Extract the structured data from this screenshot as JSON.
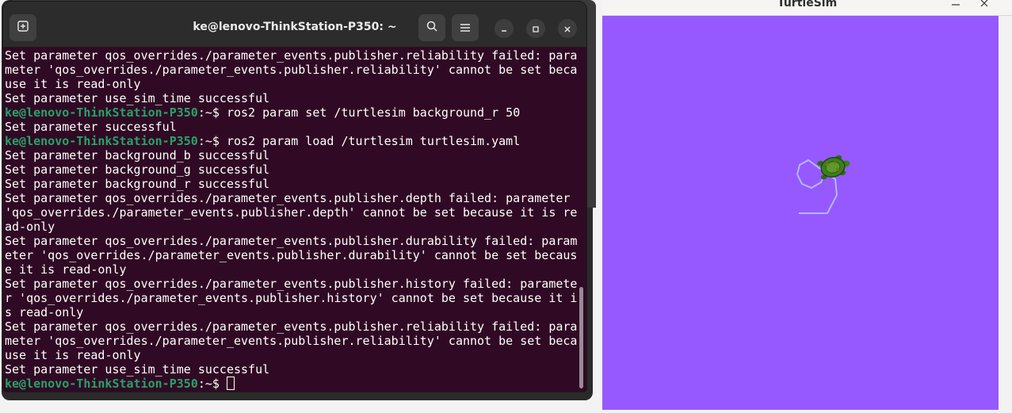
{
  "terminal": {
    "title": "ke@lenovo-ThinkStation-P350: ~",
    "icons": {
      "new_tab": "new-tab-icon",
      "search": "search-icon",
      "menu": "hamburger-menu-icon",
      "minimize": "minimize-icon",
      "maximize": "maximize-icon",
      "close": "close-icon"
    },
    "colors": {
      "background": "#300a24",
      "prompt_user": "#26a269",
      "text": "#ffffff"
    },
    "prompt_user": "ke@lenovo-ThinkStation-P350",
    "prompt_suffix": ":~$ ",
    "lines": [
      {
        "type": "text",
        "text": "Set parameter qos_overrides./parameter_events.publisher.reliability failed: para"
      },
      {
        "type": "text",
        "text": "meter 'qos_overrides./parameter_events.publisher.reliability' cannot be set beca"
      },
      {
        "type": "text",
        "text": "use it is read-only"
      },
      {
        "type": "text",
        "text": "Set parameter use_sim_time successful"
      },
      {
        "type": "prompt",
        "text": "ros2 param set /turtlesim background_r 50"
      },
      {
        "type": "text",
        "text": "Set parameter successful"
      },
      {
        "type": "prompt",
        "text": "ros2 param load /turtlesim turtlesim.yaml"
      },
      {
        "type": "text",
        "text": "Set parameter background_b successful"
      },
      {
        "type": "text",
        "text": "Set parameter background_g successful"
      },
      {
        "type": "text",
        "text": "Set parameter background_r successful"
      },
      {
        "type": "text",
        "text": "Set parameter qos_overrides./parameter_events.publisher.depth failed: parameter"
      },
      {
        "type": "text",
        "text": "'qos_overrides./parameter_events.publisher.depth' cannot be set because it is re"
      },
      {
        "type": "text",
        "text": "ad-only"
      },
      {
        "type": "text",
        "text": "Set parameter qos_overrides./parameter_events.publisher.durability failed: param"
      },
      {
        "type": "text",
        "text": "eter 'qos_overrides./parameter_events.publisher.durability' cannot be set becaus"
      },
      {
        "type": "text",
        "text": "e it is read-only"
      },
      {
        "type": "text",
        "text": "Set parameter qos_overrides./parameter_events.publisher.history failed: paramete"
      },
      {
        "type": "text",
        "text": "r 'qos_overrides./parameter_events.publisher.history' cannot be set because it i"
      },
      {
        "type": "text",
        "text": "s read-only"
      },
      {
        "type": "text",
        "text": "Set parameter qos_overrides./parameter_events.publisher.reliability failed: para"
      },
      {
        "type": "text",
        "text": "meter 'qos_overrides./parameter_events.publisher.reliability' cannot be set beca"
      },
      {
        "type": "text",
        "text": "use it is read-only"
      },
      {
        "type": "text",
        "text": "Set parameter use_sim_time successful"
      },
      {
        "type": "prompt_cursor",
        "text": ""
      }
    ]
  },
  "turtlesim": {
    "title": "TurtleSim",
    "background_color": "#9659ff",
    "pen_color": "#b3b8ff",
    "icons": {
      "minimize": "minimize-icon",
      "close": "close-icon",
      "turtle": "turtle-icon"
    }
  }
}
